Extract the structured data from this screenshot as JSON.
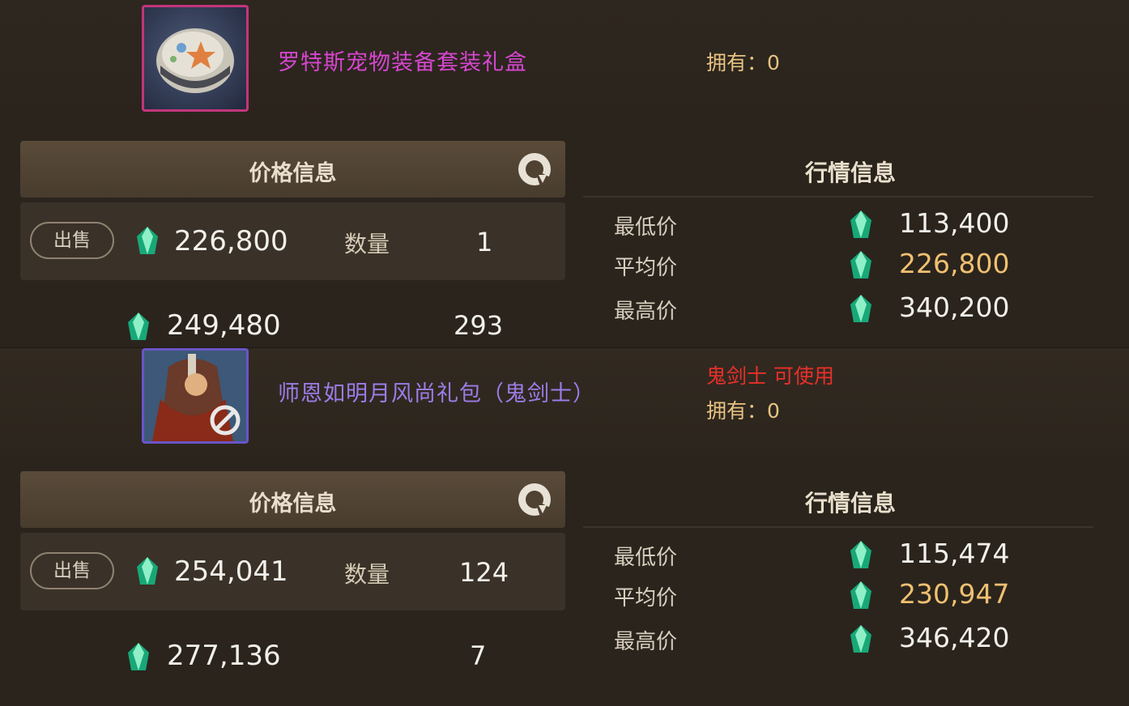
{
  "listings": [
    {
      "name": "罗特斯宠物装备套装礼盒",
      "usable": "",
      "owned": "拥有：0",
      "price_header": "价格信息",
      "sell_label": "出售",
      "sell_price": "226,800",
      "quantity_label": "数量",
      "sell_quantity": "1",
      "next_price": "249,480",
      "next_quantity": "293",
      "market_header": "行情信息",
      "market": {
        "min_label": "最低价",
        "min_value": "113,400",
        "avg_label": "平均价",
        "avg_value": "226,800",
        "max_label": "最高价",
        "max_value": "340,200"
      }
    },
    {
      "name": "师恩如明月风尚礼包（鬼剑士）",
      "usable": "鬼剑士 可使用",
      "owned": "拥有：0",
      "price_header": "价格信息",
      "sell_label": "出售",
      "sell_price": "254,041",
      "quantity_label": "数量",
      "sell_quantity": "124",
      "next_price": "277,136",
      "next_quantity": "7",
      "market_header": "行情信息",
      "market": {
        "min_label": "最低价",
        "min_value": "115,474",
        "avg_label": "平均价",
        "avg_value": "230,947",
        "max_label": "最高价",
        "max_value": "346,420"
      }
    }
  ],
  "colors": {
    "epic_name": "#d646d0",
    "rare_name": "#9d7ce8",
    "usable_text": "#e8302a",
    "owned_text": "#e7c383",
    "avg_price": "#f0c070"
  },
  "icons": [
    "gem-icon",
    "refresh-icon",
    "pet-gift-box-icon",
    "costume-pack-icon",
    "no-use-icon"
  ]
}
